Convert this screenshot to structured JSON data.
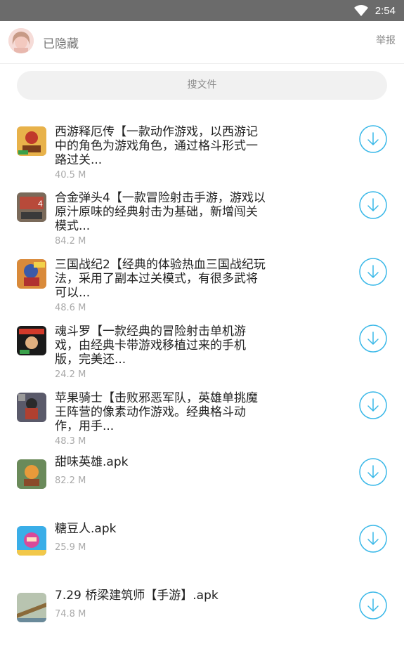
{
  "status_bar": {
    "time": "2:54"
  },
  "header": {
    "username": "已隐藏",
    "report_label": "举报"
  },
  "search": {
    "placeholder": "搜文件"
  },
  "files": [
    {
      "title": "西游释厄传【一款动作游戏，以西游记中的角色为游戏角色，通过格斗形式一路过关...",
      "size": "40.5 M",
      "icon": "game-thumbnail-icon"
    },
    {
      "title": "合金弹头4【一款冒险射击手游，游戏以原汁原味的经典射击为基础，新增闯关模式...",
      "size": "84.2 M",
      "icon": "game-thumbnail-icon"
    },
    {
      "title": "三国战纪2【经典的体验热血三国战纪玩法，采用了副本过关模式，有很多武将可以...",
      "size": "48.6 M",
      "icon": "game-thumbnail-icon"
    },
    {
      "title": "魂斗罗【一款经典的冒险射击单机游戏，由经典卡带游戏移植过来的手机版，完美还...",
      "size": "24.2 M",
      "icon": "game-thumbnail-icon"
    },
    {
      "title": "苹果骑士【击败邪恶军队，英雄单挑魔王阵营的像素动作游戏。经典格斗动作，用手...",
      "size": "48.3 M",
      "icon": "game-thumbnail-icon"
    },
    {
      "title": "甜味英雄.apk",
      "size": "82.2 M",
      "icon": "game-thumbnail-icon"
    },
    {
      "title": "糖豆人.apk",
      "size": "25.9 M",
      "icon": "game-thumbnail-icon"
    },
    {
      "title": "7.29 桥梁建筑师【手游】.apk",
      "size": "74.8 M",
      "icon": "game-thumbnail-icon"
    }
  ],
  "colors": {
    "accent": "#39b8e8",
    "status_bar": "#6b6b6b"
  }
}
